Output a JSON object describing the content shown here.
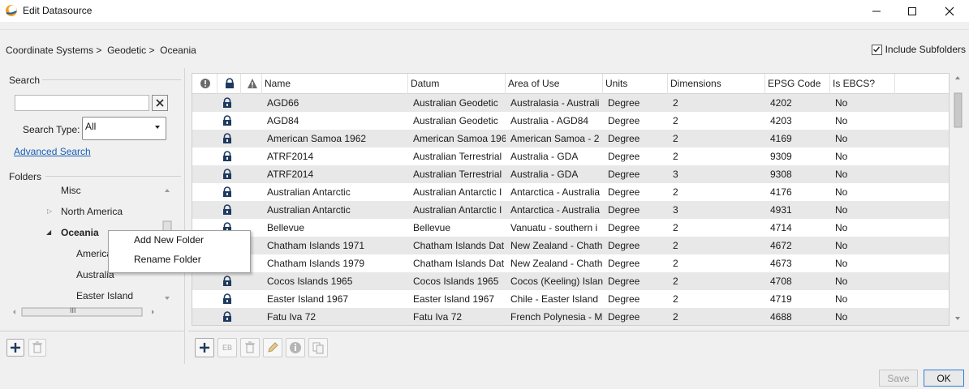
{
  "window": {
    "title": "Edit Datasource",
    "controls": {
      "minimize": "minimize-icon",
      "maximize": "maximize-icon",
      "close": "close-icon"
    }
  },
  "breadcrumb": {
    "items": [
      "Coordinate Systems",
      "Geodetic",
      "Oceania"
    ],
    "separator": ">"
  },
  "include_subfolders": {
    "label": "Include Subfolders",
    "checked": true
  },
  "search": {
    "group_label": "Search",
    "input_value": "",
    "search_type_label": "Search Type:",
    "search_type_value": "All",
    "advanced_link": "Advanced Search"
  },
  "folders": {
    "group_label": "Folders",
    "items": [
      {
        "label": "Misc",
        "expander": ""
      },
      {
        "label": "North America",
        "expander": "collapsed"
      },
      {
        "label": "Oceania",
        "expander": "expanded",
        "selected": true
      },
      {
        "label": "America"
      },
      {
        "label": "Australia"
      },
      {
        "label": "Easter Island"
      }
    ],
    "hscroll_thumb_label": "III"
  },
  "context_menu": {
    "items": [
      "Add New Folder",
      "Rename Folder"
    ]
  },
  "grid": {
    "columns": [
      "",
      "",
      "",
      "Name",
      "Datum",
      "Area of Use",
      "Units",
      "Dimensions",
      "EPSG Code",
      "Is EBCS?"
    ],
    "header_icons": [
      "info-icon",
      "lock-icon",
      "warning-icon"
    ],
    "rows": [
      [
        "AGD66",
        "Australian Geodetic",
        "Australasia - Australi",
        "Degree",
        "2",
        "4202",
        "No"
      ],
      [
        "AGD84",
        "Australian Geodetic",
        "Australia - AGD84",
        "Degree",
        "2",
        "4203",
        "No"
      ],
      [
        "American Samoa 1962",
        "American Samoa 196",
        "American Samoa - 2",
        "Degree",
        "2",
        "4169",
        "No"
      ],
      [
        "ATRF2014",
        "Australian Terrestrial",
        "Australia - GDA",
        "Degree",
        "2",
        "9309",
        "No"
      ],
      [
        "ATRF2014",
        "Australian Terrestrial",
        "Australia - GDA",
        "Degree",
        "3",
        "9308",
        "No"
      ],
      [
        "Australian Antarctic",
        "Australian Antarctic I",
        "Antarctica - Australia",
        "Degree",
        "2",
        "4176",
        "No"
      ],
      [
        "Australian Antarctic",
        "Australian Antarctic I",
        "Antarctica - Australia",
        "Degree",
        "3",
        "4931",
        "No"
      ],
      [
        "Bellevue",
        "Bellevue",
        "Vanuatu - southern i",
        "Degree",
        "2",
        "4714",
        "No"
      ],
      [
        "Chatham Islands 1971",
        "Chatham Islands Dat",
        "New Zealand - Chath",
        "Degree",
        "2",
        "4672",
        "No"
      ],
      [
        "Chatham Islands 1979",
        "Chatham Islands Dat",
        "New Zealand - Chath",
        "Degree",
        "2",
        "4673",
        "No"
      ],
      [
        "Cocos Islands 1965",
        "Cocos Islands 1965",
        "Cocos (Keeling) Islan",
        "Degree",
        "2",
        "4708",
        "No"
      ],
      [
        "Easter Island 1967",
        "Easter Island 1967",
        "Chile - Easter Island",
        "Degree",
        "2",
        "4719",
        "No"
      ],
      [
        "Fatu Iva 72",
        "Fatu Iva 72",
        "French Polynesia - M",
        "Degree",
        "2",
        "4688",
        "No"
      ]
    ]
  },
  "toolbar_left": [
    "add-icon",
    "delete-icon"
  ],
  "toolbar_right": {
    "eb_label": "EB",
    "icons": [
      "add-icon",
      "eb-icon",
      "delete-icon",
      "edit-pencil-icon",
      "info-icon",
      "copy-icon"
    ]
  },
  "footer": {
    "save_label": "Save",
    "ok_label": "OK"
  },
  "colors": {
    "link": "#1a5fb4",
    "selected_row": "#e8e8e8",
    "ok_border": "#2f7fd6",
    "logo": "#f0a020"
  }
}
